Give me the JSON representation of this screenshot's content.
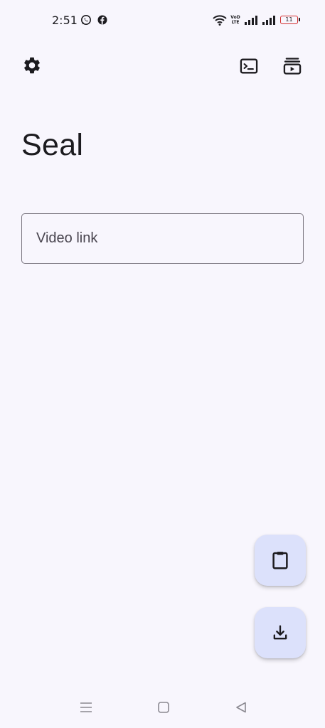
{
  "status_bar": {
    "time": "2:51",
    "volte_text": "VoD\nLTE",
    "battery_level": "11",
    "notification_icons": [
      "whatsapp-icon",
      "facebook-icon"
    ],
    "system_icons": [
      "wifi-icon",
      "volte-icon",
      "signal-icon",
      "signal-icon",
      "battery-icon"
    ],
    "battery_outline_color": "#d32f2f"
  },
  "app": {
    "title": "Seal",
    "settings_icon": "gear-icon",
    "actions": [
      "terminal-icon",
      "queue-icon"
    ]
  },
  "link_input": {
    "placeholder": "Video link",
    "value": ""
  },
  "fabs": [
    {
      "icon": "clipboard-icon"
    },
    {
      "icon": "download-icon"
    }
  ],
  "nav_bar": {
    "buttons": [
      "menu-icon",
      "home-icon",
      "back-icon"
    ]
  },
  "colors": {
    "background": "#f8f6fd",
    "fab_background": "#dce1fb",
    "outline": "#79747e",
    "on_surface": "#1c1b1f"
  }
}
